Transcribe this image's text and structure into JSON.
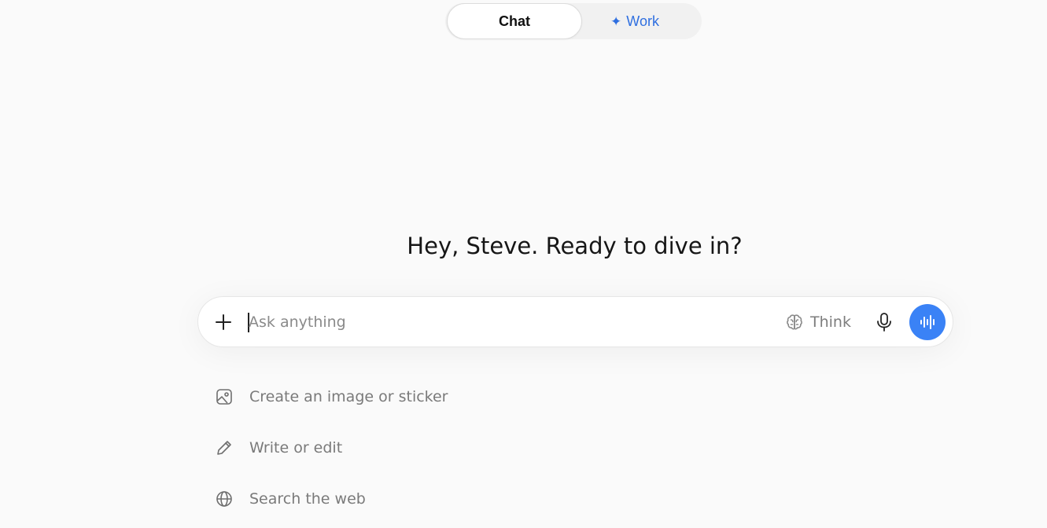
{
  "mode_toggle": {
    "chat_label": "Chat",
    "work_label": "Work",
    "work_icon": "sparkle-icon",
    "selected": "Chat",
    "work_color": "#2f6fe0"
  },
  "greeting": "Hey, Steve. Ready to dive in?",
  "composer": {
    "placeholder": "Ask anything",
    "value": "",
    "think_label": "Think",
    "icons": [
      "plus-icon",
      "brain-icon",
      "microphone-icon",
      "voice-wave-icon"
    ],
    "accent": "#3a82f6"
  },
  "suggestions": [
    {
      "label": "Create an image or sticker",
      "icon": "image-icon"
    },
    {
      "label": "Write or edit",
      "icon": "pencil-icon"
    },
    {
      "label": "Search the web",
      "icon": "globe-icon"
    }
  ]
}
